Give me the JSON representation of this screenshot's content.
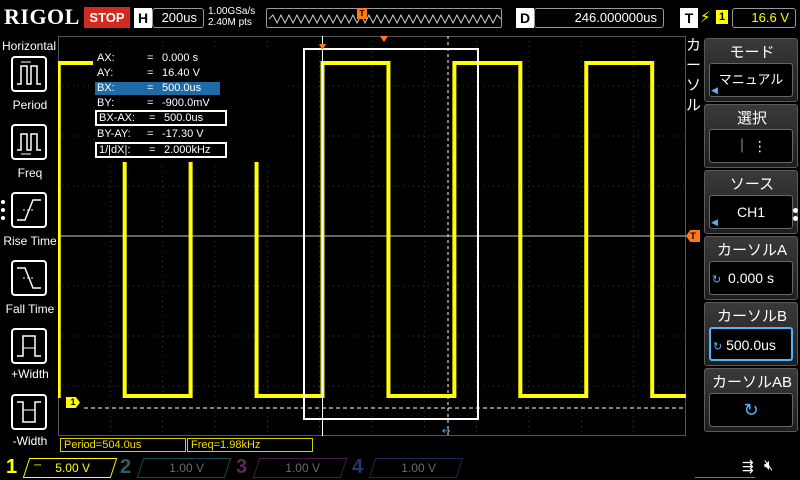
{
  "topbar": {
    "brand": "RIGOL",
    "run_state": "STOP",
    "timebase_key": "H",
    "timebase_value": "200us",
    "sample_rate": "1.00GSa/s",
    "memory_points": "2.40M pts",
    "trigger_marker": "T",
    "delay_key": "D",
    "delay_value": "246.000000us",
    "trigger_key": "T",
    "trigger_source": "1",
    "trigger_level": "16.6 V"
  },
  "left_panel": {
    "title": "Horizontal",
    "buttons": [
      {
        "label": "Period",
        "icon": "period-icon"
      },
      {
        "label": "Freq",
        "icon": "freq-icon"
      },
      {
        "label": "Rise Time",
        "icon": "rise-time-icon"
      },
      {
        "label": "Fall Time",
        "icon": "fall-time-icon"
      },
      {
        "label": "+Width",
        "icon": "positive-width-icon"
      },
      {
        "label": "-Width",
        "icon": "negative-width-icon"
      }
    ]
  },
  "cursor_readout": {
    "rows": [
      {
        "key": "AX:",
        "eq": "=",
        "value": "0.000 s"
      },
      {
        "key": "AY:",
        "eq": "=",
        "value": "16.40 V"
      },
      {
        "key": "BX:",
        "eq": "=",
        "value": "500.0us"
      },
      {
        "key": "BY:",
        "eq": "=",
        "value": "-900.0mV"
      },
      {
        "key": "BX-AX:",
        "eq": "=",
        "value": "500.0us"
      },
      {
        "key": "BY-AY:",
        "eq": "=",
        "value": "-17.30 V"
      },
      {
        "key": "1/|dX|:",
        "eq": "=",
        "value": "2.000kHz"
      }
    ]
  },
  "side_label": {
    "text": "カーソル"
  },
  "right_panel": {
    "mode": {
      "title": "モード",
      "value": "マニュアル"
    },
    "select": {
      "title": "選択",
      "value": "｜ ⋮"
    },
    "source": {
      "title": "ソース",
      "value": "CH1"
    },
    "cursor_a": {
      "title": "カーソルA",
      "value": "0.000 s"
    },
    "cursor_b": {
      "title": "カーソルB",
      "value": "500.0us"
    },
    "cursor_ab": {
      "title": "カーソルAB",
      "value": "↻"
    }
  },
  "status": {
    "period": "Period=504.0us",
    "freq": "Freq=1.98kHz"
  },
  "channels": [
    {
      "number": "1",
      "scale": "5.00 V",
      "color": "#ffff00",
      "active": true
    },
    {
      "number": "2",
      "scale": "1.00 V",
      "color": "#00e5ff",
      "active": false
    },
    {
      "number": "3",
      "scale": "1.00 V",
      "color": "#ff00ff",
      "active": false
    },
    {
      "number": "4",
      "scale": "1.00 V",
      "color": "#1e6bff",
      "active": false
    }
  ],
  "ch1_marker": "1",
  "trigger_level_marker": "T",
  "colors": {
    "trace": "#ffff00",
    "trigger": "#ff7a14",
    "accent": "#4fb3ff",
    "stop": "#d12a1e"
  },
  "waveform": {
    "type": "square",
    "high_level_v": 16.4,
    "low_level_v": -0.9,
    "period_us": 504.0,
    "frequency_khz": 1.98
  }
}
